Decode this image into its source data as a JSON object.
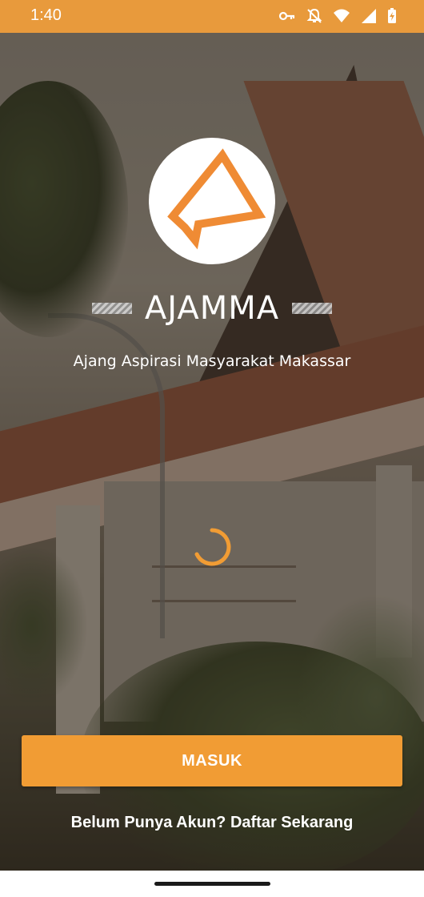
{
  "status_bar": {
    "time": "1:40",
    "icons": [
      "vpn-key-icon",
      "notifications-off-icon",
      "wifi-icon",
      "signal-icon",
      "battery-charging-icon"
    ]
  },
  "app": {
    "title": "AJAMMA",
    "subtitle": "Ajang Aspirasi Masyarakat Makassar"
  },
  "actions": {
    "login_label": "MASUK",
    "register_label": "Belum Punya Akun? Daftar Sekarang"
  },
  "colors": {
    "accent": "#f19c34",
    "status_bar": "#e89a3c",
    "logo_orange": "#ef8b34",
    "text": "#ffffff"
  }
}
